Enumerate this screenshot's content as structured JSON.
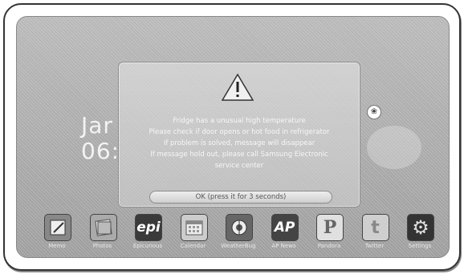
{
  "status_bar": {
    "items": [
      "",
      ""
    ]
  },
  "home": {
    "date_partial": "Jar",
    "time_partial": "06:0"
  },
  "dialog": {
    "lines": [
      "Fridge has a unusual high temperature",
      "Please check if door opens or hot food in refrigerator",
      "If problem is solved, message will disappear",
      "If message hold out, please call Samsung Electronic",
      "service center"
    ],
    "ok_label": "OK (press it for 3 seconds)"
  },
  "dock": {
    "apps": [
      {
        "label": "Memo",
        "icon": "memo-icon",
        "glyph": ""
      },
      {
        "label": "Photos",
        "icon": "photos-icon",
        "glyph": ""
      },
      {
        "label": "Epicurious",
        "icon": "epi-icon",
        "glyph": "epi"
      },
      {
        "label": "Calendar",
        "icon": "calendar-icon",
        "glyph": ""
      },
      {
        "label": "WeatherBug",
        "icon": "weatherbug-icon",
        "glyph": ""
      },
      {
        "label": "AP News",
        "icon": "ap-icon",
        "glyph": "AP"
      },
      {
        "label": "Pandora",
        "icon": "pandora-icon",
        "glyph": "P"
      },
      {
        "label": "Twitter",
        "icon": "twitter-icon",
        "glyph": "t"
      },
      {
        "label": "Settings",
        "icon": "gear-icon",
        "glyph": "⚙"
      }
    ]
  }
}
